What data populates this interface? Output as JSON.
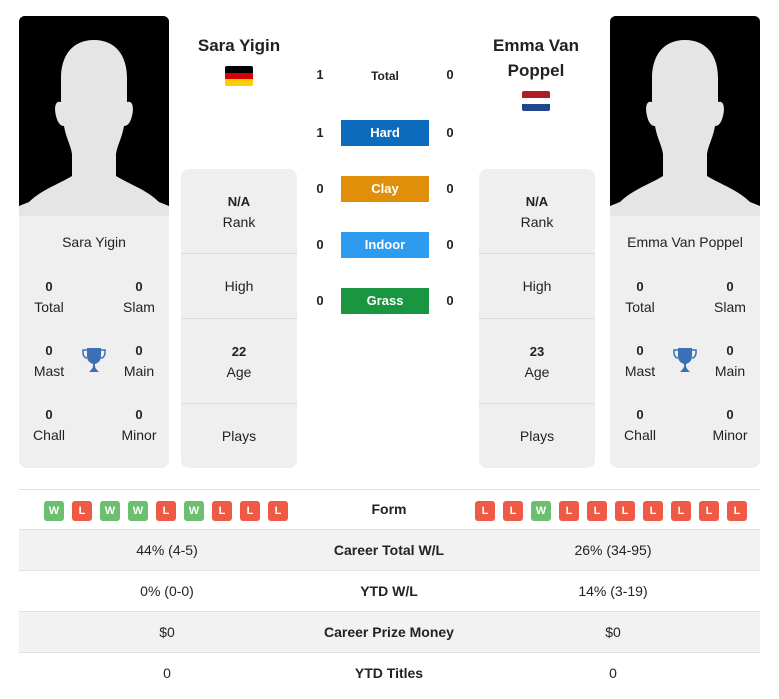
{
  "colors": {
    "hard": "#0c6bbd",
    "clay": "#e08f0b",
    "indoor": "#2d9cf0",
    "grass": "#1a9640",
    "win": "#6bbf6e",
    "loss": "#ee5a45",
    "trophy": "#3b6fb6"
  },
  "left_player": {
    "name": "Sara Yigin",
    "flag": "germany-flag",
    "flag_colors": [
      "#000000",
      "#dd0000",
      "#ffce00"
    ],
    "titles": {
      "total": {
        "value": "0",
        "label": "Total"
      },
      "slam": {
        "value": "0",
        "label": "Slam"
      },
      "mast": {
        "value": "0",
        "label": "Mast"
      },
      "main": {
        "value": "0",
        "label": "Main"
      },
      "chall": {
        "value": "0",
        "label": "Chall"
      },
      "minor": {
        "value": "0",
        "label": "Minor"
      }
    },
    "info": {
      "rank": {
        "value": "N/A",
        "label": "Rank"
      },
      "high": {
        "value": "",
        "label": "High"
      },
      "age": {
        "value": "22",
        "label": "Age"
      },
      "plays": {
        "value": "",
        "label": "Plays"
      }
    },
    "form": [
      "W",
      "L",
      "W",
      "W",
      "L",
      "W",
      "L",
      "L",
      "L"
    ]
  },
  "right_player": {
    "name": "Emma Van Poppel",
    "flag": "netherlands-flag",
    "flag_colors": [
      "#ae1c28",
      "#ffffff",
      "#21468b"
    ],
    "titles": {
      "total": {
        "value": "0",
        "label": "Total"
      },
      "slam": {
        "value": "0",
        "label": "Slam"
      },
      "mast": {
        "value": "0",
        "label": "Mast"
      },
      "main": {
        "value": "0",
        "label": "Main"
      },
      "chall": {
        "value": "0",
        "label": "Chall"
      },
      "minor": {
        "value": "0",
        "label": "Minor"
      }
    },
    "info": {
      "rank": {
        "value": "N/A",
        "label": "Rank"
      },
      "high": {
        "value": "",
        "label": "High"
      },
      "age": {
        "value": "23",
        "label": "Age"
      },
      "plays": {
        "value": "",
        "label": "Plays"
      }
    },
    "form": [
      "L",
      "L",
      "W",
      "L",
      "L",
      "L",
      "L",
      "L",
      "L",
      "L"
    ]
  },
  "h2h": [
    {
      "label": "Total",
      "left": "1",
      "right": "0",
      "surface": "total"
    },
    {
      "label": "Hard",
      "left": "1",
      "right": "0",
      "surface": "hard"
    },
    {
      "label": "Clay",
      "left": "0",
      "right": "0",
      "surface": "clay"
    },
    {
      "label": "Indoor",
      "left": "0",
      "right": "0",
      "surface": "indoor"
    },
    {
      "label": "Grass",
      "left": "0",
      "right": "0",
      "surface": "grass"
    }
  ],
  "form_label": "Form",
  "stats": [
    {
      "label": "Career Total W/L",
      "left": "44% (4-5)",
      "right": "26% (34-95)"
    },
    {
      "label": "YTD W/L",
      "left": "0% (0-0)",
      "right": "14% (3-19)"
    },
    {
      "label": "Career Prize Money",
      "left": "$0",
      "right": "$0"
    },
    {
      "label": "YTD Titles",
      "left": "0",
      "right": "0"
    }
  ]
}
